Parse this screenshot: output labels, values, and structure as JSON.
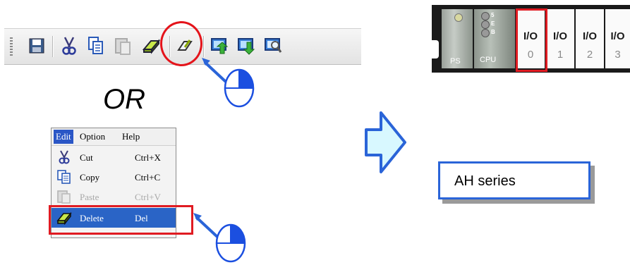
{
  "toolbar": {
    "buttons": [
      "save-icon",
      "cut-icon",
      "copy-icon",
      "paste-icon",
      "delete-eraser-icon",
      "rename-icon",
      "upload-icon",
      "download-icon",
      "search-icon"
    ]
  },
  "or_text": "OR",
  "menu": {
    "bar": {
      "edit": "Edit",
      "option": "Option",
      "help": "Help"
    },
    "items": [
      {
        "label": "Cut",
        "shortcut": "Ctrl+X",
        "enabled": true
      },
      {
        "label": "Copy",
        "shortcut": "Ctrl+C",
        "enabled": true
      },
      {
        "label": "Paste",
        "shortcut": "Ctrl+V",
        "enabled": false
      },
      {
        "label": "Delete",
        "shortcut": "Del",
        "enabled": true,
        "selected": true
      }
    ]
  },
  "rack": {
    "ps_label": "PS",
    "cpu_label": "CPU",
    "cpu_leds": [
      "5",
      "E",
      "B"
    ],
    "slots": [
      {
        "label": "I/O",
        "number": "0",
        "selected": true
      },
      {
        "label": "I/O",
        "number": "1"
      },
      {
        "label": "I/O",
        "number": "2"
      },
      {
        "label": "I/O",
        "number": "3"
      }
    ]
  },
  "series_label": "AH series",
  "colors": {
    "highlight_red": "#e01b22",
    "cursor_blue": "#1b4fe0",
    "menu_selected": "#2a64c6",
    "arrow_fill": "#d8f8ff"
  }
}
